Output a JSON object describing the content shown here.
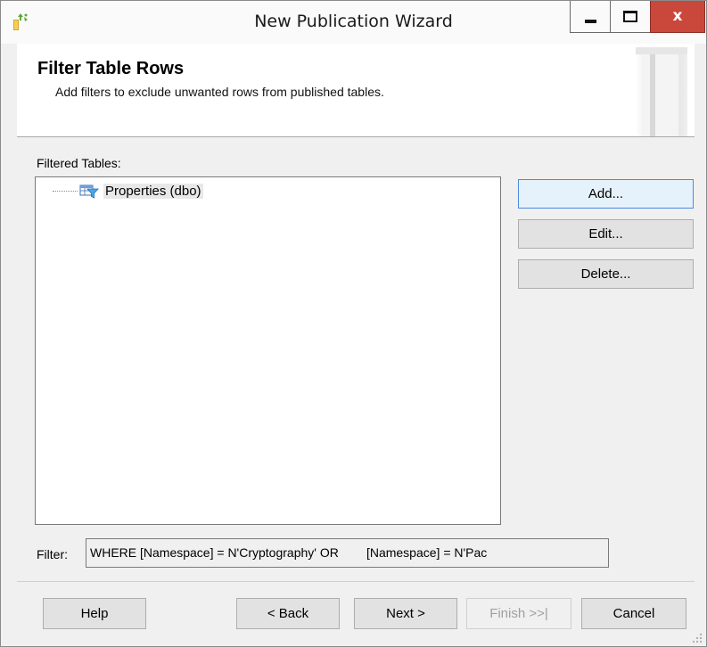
{
  "window": {
    "title": "New Publication Wizard",
    "icon": "publication-wizard-icon",
    "controls": {
      "minimize": "minimize-icon",
      "maximize": "maximize-icon",
      "close": "x"
    }
  },
  "header": {
    "title": "Filter Table Rows",
    "subtitle": "Add filters to exclude unwanted rows from published tables."
  },
  "filtered_tables": {
    "label": "Filtered Tables:",
    "items": [
      {
        "label": "Properties (dbo)",
        "icon": "filtered-table-icon",
        "selected": true
      }
    ]
  },
  "side_buttons": {
    "add": "Add...",
    "edit": "Edit...",
    "delete": "Delete..."
  },
  "filter": {
    "label": "Filter:",
    "value": "WHERE [Namespace] = N'Cryptography' OR        [Namespace] = N'Pac"
  },
  "footer": {
    "help": "Help",
    "back": "< Back",
    "next": "Next >",
    "finish": "Finish >>|",
    "cancel": "Cancel"
  },
  "colors": {
    "close_button": "#c9483b",
    "focus_border": "#4a8be0",
    "disabled_text": "#a0a0a0"
  }
}
